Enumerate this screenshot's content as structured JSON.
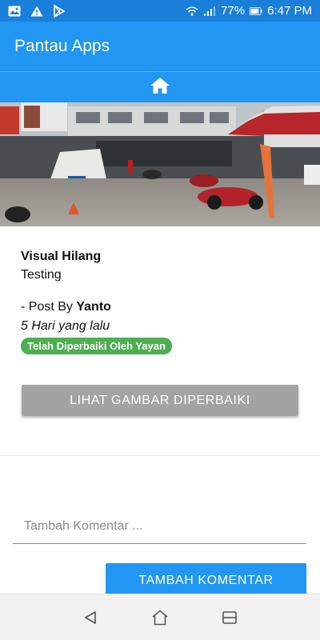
{
  "status_bar": {
    "battery": "77%",
    "time": "6:47 PM",
    "icons": [
      "image-icon",
      "warning-icon",
      "play-store-icon",
      "wifi-icon",
      "signal-icon",
      "battery-icon"
    ]
  },
  "app_bar": {
    "title": "Pantau Apps"
  },
  "home_strip": {
    "icon": "home-icon"
  },
  "post": {
    "title": "Visual Hilang",
    "description": "Testing",
    "posted_by_prefix": "- Post By ",
    "author": "Yanto",
    "time_ago": "5 Hari yang lalu",
    "status_badge": "Telah Diperbaiki Oleh Yayan"
  },
  "buttons": {
    "view_fixed_image": "LIHAT GAMBAR DIPERBAIKI",
    "add_comment": "TAMBAH KOMENTAR"
  },
  "comment": {
    "placeholder": "Tambah Komentar ..."
  },
  "nav": {
    "icons": [
      "back-icon",
      "home-icon",
      "recents-icon"
    ]
  },
  "colors": {
    "primary": "#2196f3",
    "status_bar": "#1a7fd9",
    "badge": "#4caf50",
    "gray_button": "#a3a3a3"
  }
}
